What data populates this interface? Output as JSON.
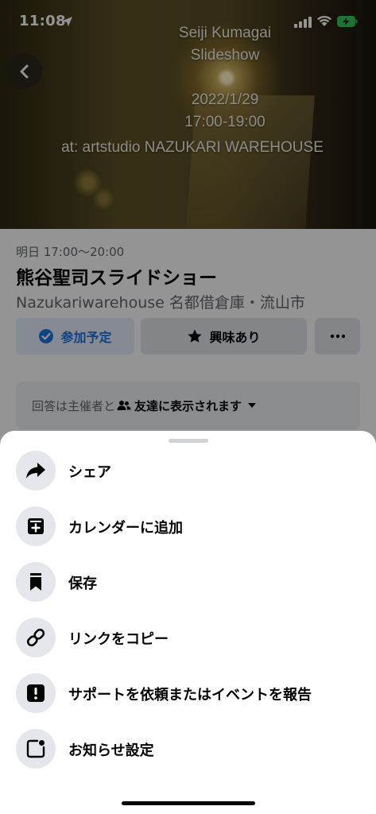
{
  "status_bar": {
    "time": "11:08"
  },
  "cover": {
    "lines": [
      "Seiji Kumagai",
      "Slideshow",
      "",
      "2022/1/29",
      "17:00-19:00"
    ],
    "venue": "at: artstudio NAZUKARI WAREHOUSE"
  },
  "event": {
    "date": "明日 17:00～20:00",
    "title": "熊谷聖司スライドショー",
    "place": "Nazukariwarehouse 名都借倉庫・流山市"
  },
  "actions": {
    "going_label": "参加予定",
    "interested_label": "興味あり"
  },
  "privacy": {
    "prefix": "回答は主催者と",
    "audience": "友達に表示されます"
  },
  "sheet": {
    "items": [
      {
        "label": "シェア",
        "icon": "share-icon"
      },
      {
        "label": "カレンダーに追加",
        "icon": "calendar-add-icon"
      },
      {
        "label": "保存",
        "icon": "bookmark-icon"
      },
      {
        "label": "リンクをコピー",
        "icon": "link-icon"
      },
      {
        "label": "サポートを依頼またはイベントを報告",
        "icon": "report-icon"
      },
      {
        "label": "お知らせ設定",
        "icon": "notification-settings-icon"
      }
    ]
  },
  "colors": {
    "accent": "#1b74e4",
    "going_bg": "#e7f0fd",
    "secondary_bg": "#e4e6eb",
    "overlay": "rgba(0,0,0,0.42)"
  }
}
